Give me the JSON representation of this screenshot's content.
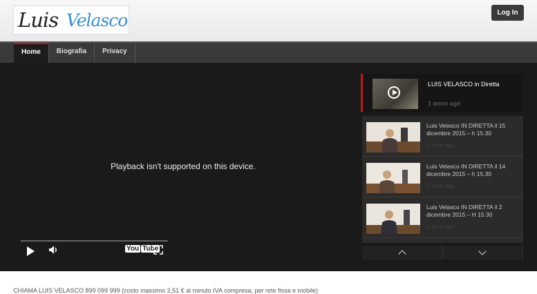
{
  "header": {
    "logo_first": "Luis",
    "logo_second": "Velasco",
    "login_label": "Log In"
  },
  "nav": {
    "tabs": [
      {
        "label": "Home"
      },
      {
        "label": "Biografia"
      },
      {
        "label": "Privacy"
      }
    ]
  },
  "player": {
    "message": "Playback isn't supported on this device.",
    "youtube_label_a": "You",
    "youtube_label_b": "Tube"
  },
  "sidebar": {
    "live": {
      "title": "LUIS VELASCO in Diretta",
      "time": "1 anno ago"
    },
    "items": [
      {
        "title": "Luis Velasco IN DIRETTA il 15 dicembre 2015 – h 15.30",
        "time": "1 anno ago"
      },
      {
        "title": "Luis Velasco IN DIRETTA il 14 dicembre 2015 – h 15.30",
        "time": "1 anno ago"
      },
      {
        "title": "Luis Velasco IN DIRETTA il 2 dicembre 2015 – H 15.30",
        "time": "1 anno ago"
      }
    ]
  },
  "footer": {
    "text": "CHIAMA LUIS VELASCO 899 099 999 (costo massimo 2,51 € al minuto IVA compresa, per rete fissa e mobile)"
  },
  "colors": {
    "accent": "#c8161d",
    "logo_blue": "#3a8fd6",
    "stage_bg": "#1a1a1a",
    "nav_bg": "#3a3a3a"
  }
}
